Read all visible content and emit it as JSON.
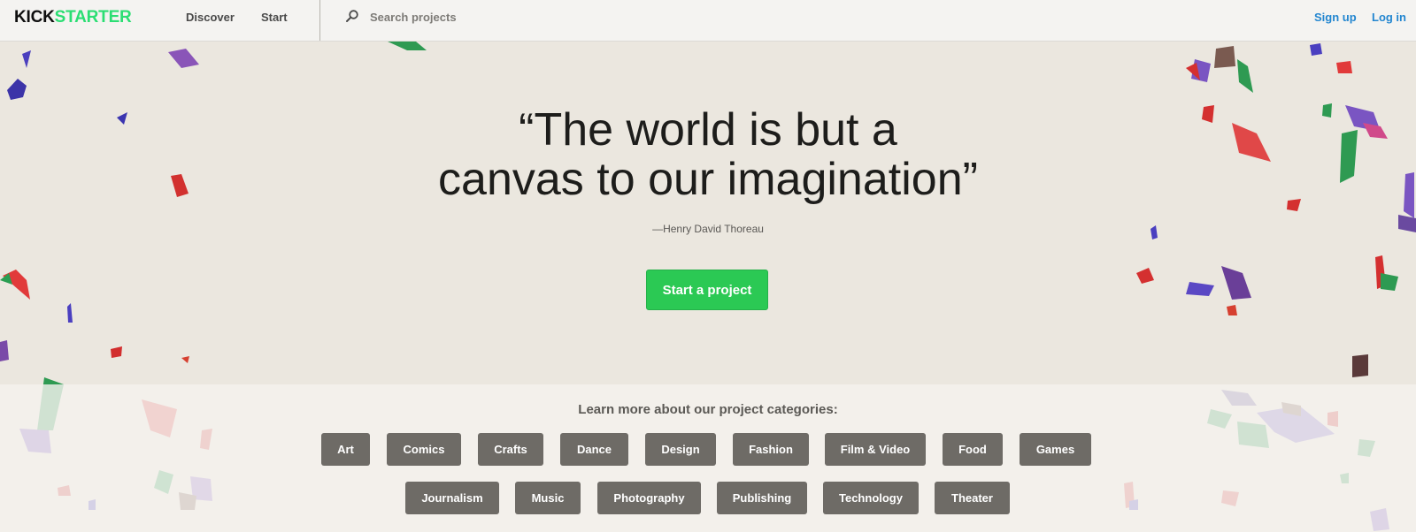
{
  "nav": {
    "logo_kick": "KICK",
    "logo_starter": "STARTER",
    "discover": "Discover",
    "start": "Start",
    "search_placeholder": "Search projects",
    "search_icon": "search-icon",
    "signup": "Sign up",
    "login": "Log in",
    "colors": {
      "logo_dark": "#0f0f0f",
      "logo_green": "#2bde73",
      "link_blue": "#2386d0"
    }
  },
  "hero": {
    "quote_line1": "“The world is but a",
    "quote_line2": "canvas to our imagination”",
    "attribution": "—Henry David Thoreau",
    "cta": "Start a project",
    "cta_color": "#2bc954"
  },
  "categories": {
    "heading": "Learn more about our project categories:",
    "row1": [
      "Art",
      "Comics",
      "Crafts",
      "Dance",
      "Design",
      "Fashion",
      "Film & Video",
      "Food",
      "Games"
    ],
    "row2": [
      "Journalism",
      "Music",
      "Photography",
      "Publishing",
      "Technology",
      "Theater"
    ],
    "pill_color": "#6e6b66"
  }
}
